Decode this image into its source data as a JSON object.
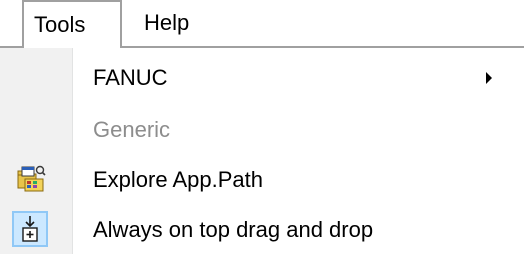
{
  "menubar": {
    "items": [
      {
        "label": "Tools"
      },
      {
        "label": "Help"
      }
    ]
  },
  "dropdown": {
    "items": [
      {
        "label": "FANUC",
        "enabled": true,
        "has_submenu": true,
        "icon": "none"
      },
      {
        "label": "Generic",
        "enabled": false,
        "has_submenu": false,
        "icon": "none"
      },
      {
        "label": "Explore App.Path",
        "enabled": true,
        "has_submenu": false,
        "icon": "folder-explore-icon"
      },
      {
        "label": "Always on top drag and drop",
        "enabled": true,
        "has_submenu": false,
        "checked": true,
        "icon": "drag-drop-icon"
      }
    ]
  },
  "colors": {
    "menu_border": "#a0a0a0",
    "gutter": "#f1f1f1",
    "disabled_text": "#8d8d8d",
    "checked_bg": "#cce8ff",
    "checked_border": "#90c8f6"
  }
}
